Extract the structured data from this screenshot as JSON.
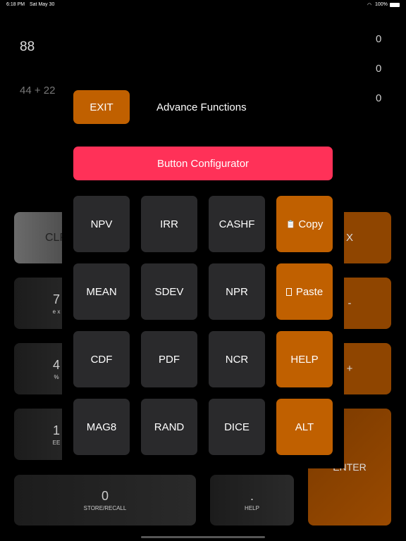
{
  "status_bar": {
    "time": "6:18 PM",
    "date": "Sat May 30",
    "battery": "100%",
    "icons": [
      "wifi-icon",
      "battery-icon"
    ]
  },
  "display": {
    "result": "88",
    "expression": "44 + 22",
    "stack": [
      "0",
      "0",
      "0"
    ]
  },
  "keypad": {
    "clear": "CLR",
    "multiply": "X",
    "minus": "-",
    "plus": "+",
    "enter": "ENTER",
    "seven": {
      "main": "7",
      "sub": "e x"
    },
    "four": {
      "main": "4",
      "sub": "%"
    },
    "one": {
      "main": "1",
      "sub": "EE"
    },
    "zero": {
      "main": "0",
      "sub": "STORE/RECALL"
    },
    "dot": {
      "main": ".",
      "sub": "HELP"
    }
  },
  "panel": {
    "exit": "EXIT",
    "title": "Advance Functions",
    "configurator": "Button Configurator",
    "grid": [
      [
        "NPV",
        "IRR",
        "CASHF",
        "Copy"
      ],
      [
        "MEAN",
        "SDEV",
        "NPR",
        "Paste"
      ],
      [
        "CDF",
        "PDF",
        "NCR",
        "HELP"
      ],
      [
        "MAG8",
        "RAND",
        "DICE",
        "ALT"
      ]
    ]
  },
  "colors": {
    "accent_orange": "#c06000",
    "configurator_pink": "#ff3158",
    "dim_orange": "#8f4500"
  }
}
